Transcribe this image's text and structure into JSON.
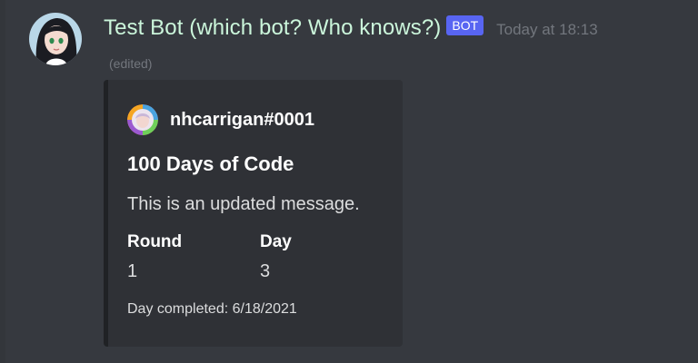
{
  "message": {
    "username": "Test Bot (which bot? Who knows?)",
    "badge": "BOT",
    "timestamp": "Today at 18:13",
    "edited_label": "(edited)",
    "avatar_icon": "anime-girl-avatar-icon"
  },
  "embed": {
    "author": {
      "name": "nhcarrigan#0001",
      "icon": "rainbow-avatar-icon"
    },
    "title": "100 Days of Code",
    "description": "This is an updated message.",
    "fields": [
      {
        "name": "Round",
        "value": "1"
      },
      {
        "name": "Day",
        "value": "3"
      }
    ],
    "footer": "Day completed: 6/18/2021"
  },
  "colors": {
    "background": "#36393f",
    "embed_background": "#2f3136",
    "embed_border": "#202225",
    "username": "#cbf6db",
    "bot_badge": "#5865f2",
    "muted_text": "#72767d"
  }
}
